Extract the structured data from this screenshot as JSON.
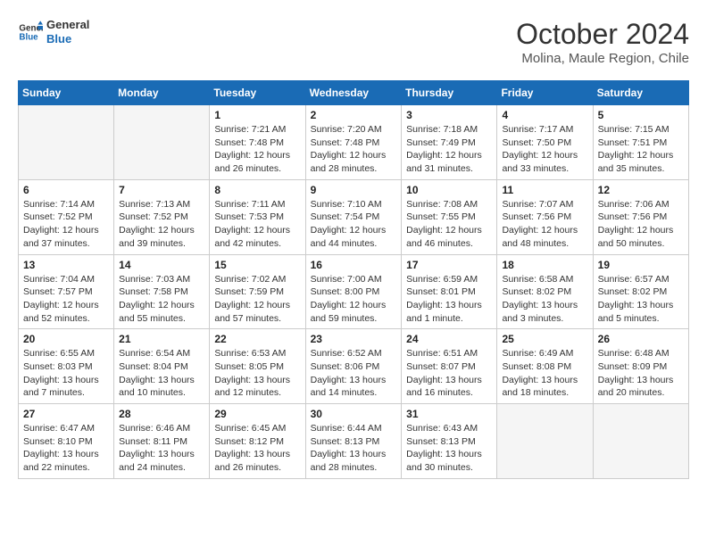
{
  "header": {
    "logo_line1": "General",
    "logo_line2": "Blue",
    "month_year": "October 2024",
    "location": "Molina, Maule Region, Chile"
  },
  "weekdays": [
    "Sunday",
    "Monday",
    "Tuesday",
    "Wednesday",
    "Thursday",
    "Friday",
    "Saturday"
  ],
  "weeks": [
    [
      {
        "day": "",
        "info": ""
      },
      {
        "day": "",
        "info": ""
      },
      {
        "day": "1",
        "info": "Sunrise: 7:21 AM\nSunset: 7:48 PM\nDaylight: 12 hours and 26 minutes."
      },
      {
        "day": "2",
        "info": "Sunrise: 7:20 AM\nSunset: 7:48 PM\nDaylight: 12 hours and 28 minutes."
      },
      {
        "day": "3",
        "info": "Sunrise: 7:18 AM\nSunset: 7:49 PM\nDaylight: 12 hours and 31 minutes."
      },
      {
        "day": "4",
        "info": "Sunrise: 7:17 AM\nSunset: 7:50 PM\nDaylight: 12 hours and 33 minutes."
      },
      {
        "day": "5",
        "info": "Sunrise: 7:15 AM\nSunset: 7:51 PM\nDaylight: 12 hours and 35 minutes."
      }
    ],
    [
      {
        "day": "6",
        "info": "Sunrise: 7:14 AM\nSunset: 7:52 PM\nDaylight: 12 hours and 37 minutes."
      },
      {
        "day": "7",
        "info": "Sunrise: 7:13 AM\nSunset: 7:52 PM\nDaylight: 12 hours and 39 minutes."
      },
      {
        "day": "8",
        "info": "Sunrise: 7:11 AM\nSunset: 7:53 PM\nDaylight: 12 hours and 42 minutes."
      },
      {
        "day": "9",
        "info": "Sunrise: 7:10 AM\nSunset: 7:54 PM\nDaylight: 12 hours and 44 minutes."
      },
      {
        "day": "10",
        "info": "Sunrise: 7:08 AM\nSunset: 7:55 PM\nDaylight: 12 hours and 46 minutes."
      },
      {
        "day": "11",
        "info": "Sunrise: 7:07 AM\nSunset: 7:56 PM\nDaylight: 12 hours and 48 minutes."
      },
      {
        "day": "12",
        "info": "Sunrise: 7:06 AM\nSunset: 7:56 PM\nDaylight: 12 hours and 50 minutes."
      }
    ],
    [
      {
        "day": "13",
        "info": "Sunrise: 7:04 AM\nSunset: 7:57 PM\nDaylight: 12 hours and 52 minutes."
      },
      {
        "day": "14",
        "info": "Sunrise: 7:03 AM\nSunset: 7:58 PM\nDaylight: 12 hours and 55 minutes."
      },
      {
        "day": "15",
        "info": "Sunrise: 7:02 AM\nSunset: 7:59 PM\nDaylight: 12 hours and 57 minutes."
      },
      {
        "day": "16",
        "info": "Sunrise: 7:00 AM\nSunset: 8:00 PM\nDaylight: 12 hours and 59 minutes."
      },
      {
        "day": "17",
        "info": "Sunrise: 6:59 AM\nSunset: 8:01 PM\nDaylight: 13 hours and 1 minute."
      },
      {
        "day": "18",
        "info": "Sunrise: 6:58 AM\nSunset: 8:02 PM\nDaylight: 13 hours and 3 minutes."
      },
      {
        "day": "19",
        "info": "Sunrise: 6:57 AM\nSunset: 8:02 PM\nDaylight: 13 hours and 5 minutes."
      }
    ],
    [
      {
        "day": "20",
        "info": "Sunrise: 6:55 AM\nSunset: 8:03 PM\nDaylight: 13 hours and 7 minutes."
      },
      {
        "day": "21",
        "info": "Sunrise: 6:54 AM\nSunset: 8:04 PM\nDaylight: 13 hours and 10 minutes."
      },
      {
        "day": "22",
        "info": "Sunrise: 6:53 AM\nSunset: 8:05 PM\nDaylight: 13 hours and 12 minutes."
      },
      {
        "day": "23",
        "info": "Sunrise: 6:52 AM\nSunset: 8:06 PM\nDaylight: 13 hours and 14 minutes."
      },
      {
        "day": "24",
        "info": "Sunrise: 6:51 AM\nSunset: 8:07 PM\nDaylight: 13 hours and 16 minutes."
      },
      {
        "day": "25",
        "info": "Sunrise: 6:49 AM\nSunset: 8:08 PM\nDaylight: 13 hours and 18 minutes."
      },
      {
        "day": "26",
        "info": "Sunrise: 6:48 AM\nSunset: 8:09 PM\nDaylight: 13 hours and 20 minutes."
      }
    ],
    [
      {
        "day": "27",
        "info": "Sunrise: 6:47 AM\nSunset: 8:10 PM\nDaylight: 13 hours and 22 minutes."
      },
      {
        "day": "28",
        "info": "Sunrise: 6:46 AM\nSunset: 8:11 PM\nDaylight: 13 hours and 24 minutes."
      },
      {
        "day": "29",
        "info": "Sunrise: 6:45 AM\nSunset: 8:12 PM\nDaylight: 13 hours and 26 minutes."
      },
      {
        "day": "30",
        "info": "Sunrise: 6:44 AM\nSunset: 8:13 PM\nDaylight: 13 hours and 28 minutes."
      },
      {
        "day": "31",
        "info": "Sunrise: 6:43 AM\nSunset: 8:13 PM\nDaylight: 13 hours and 30 minutes."
      },
      {
        "day": "",
        "info": ""
      },
      {
        "day": "",
        "info": ""
      }
    ]
  ]
}
